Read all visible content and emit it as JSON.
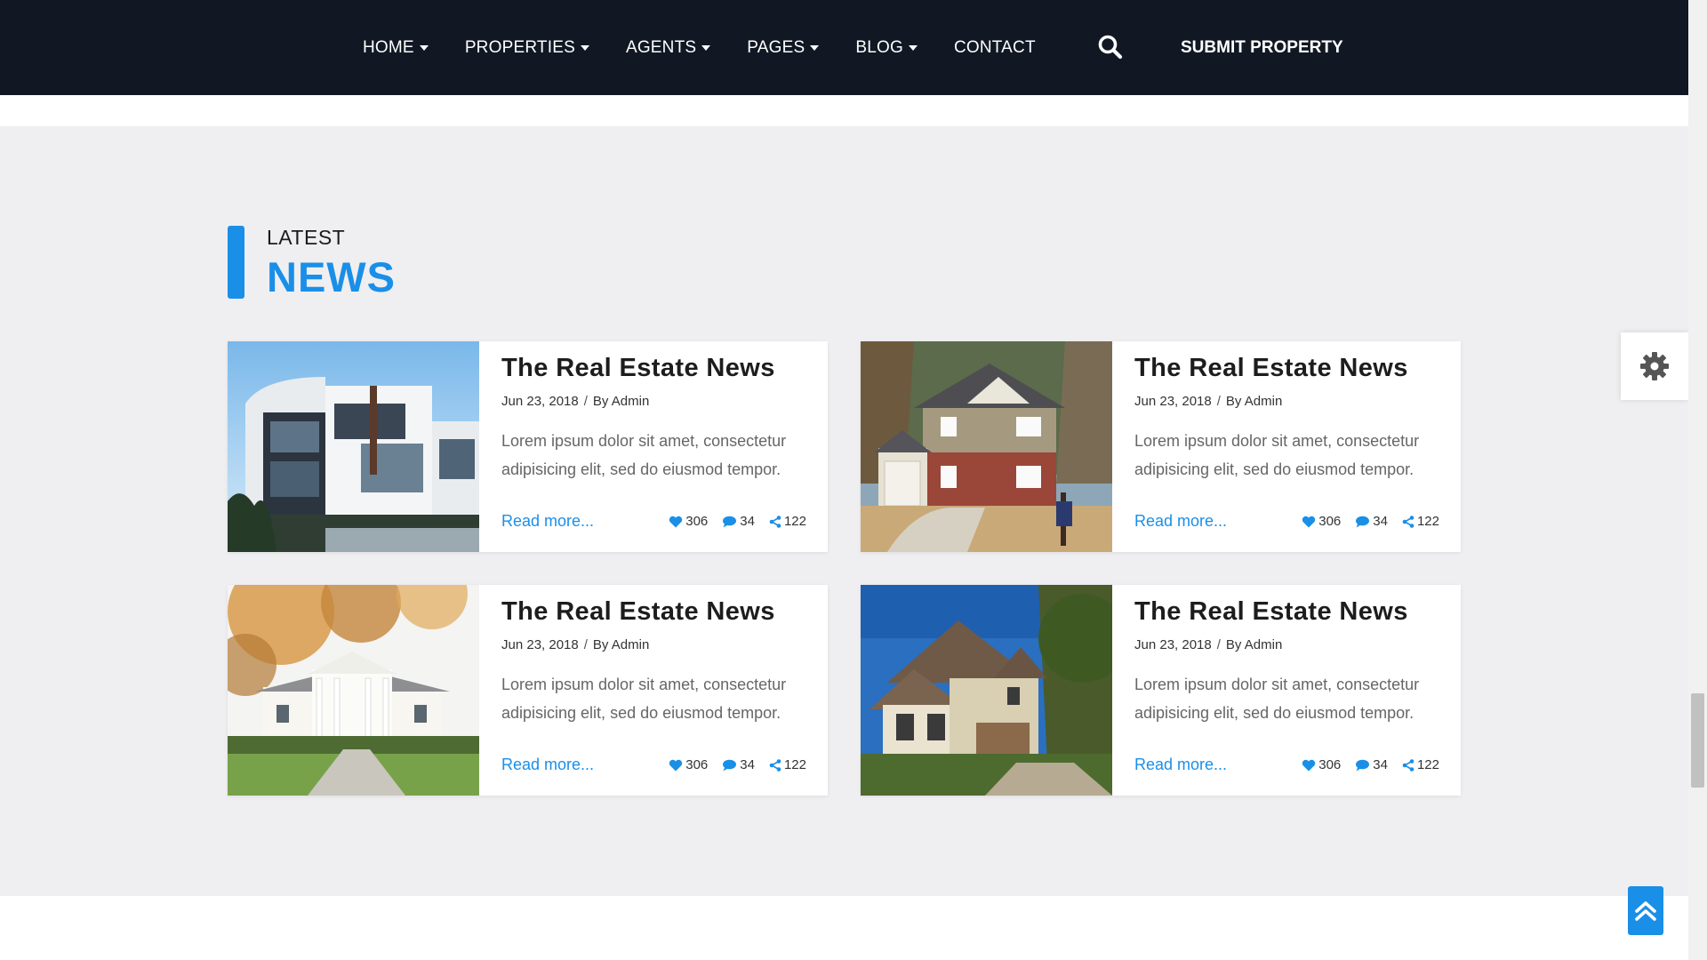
{
  "nav": {
    "items": [
      {
        "label": "HOME",
        "dropdown": true
      },
      {
        "label": "PROPERTIES",
        "dropdown": true
      },
      {
        "label": "AGENTS",
        "dropdown": true
      },
      {
        "label": "PAGES",
        "dropdown": true
      },
      {
        "label": "BLOG",
        "dropdown": true
      },
      {
        "label": "CONTACT",
        "dropdown": false
      }
    ],
    "search_icon": "search-icon",
    "submit_label": "SUBMIT PROPERTY"
  },
  "section": {
    "small_heading": "LATEST",
    "big_heading": "NEWS"
  },
  "cards": [
    {
      "title": "The Real Estate News",
      "date": "Jun 23, 2018",
      "author": "By Admin",
      "text": "Lorem ipsum dolor sit amet, consectetur adipisicing elit, sed do eiusmod tempor.",
      "read_more": "Read more...",
      "likes": "306",
      "comments": "34",
      "shares": "122"
    },
    {
      "title": "The Real Estate News",
      "date": "Jun 23, 2018",
      "author": "By Admin",
      "text": "Lorem ipsum dolor sit amet, consectetur adipisicing elit, sed do eiusmod tempor.",
      "read_more": "Read more...",
      "likes": "306",
      "comments": "34",
      "shares": "122"
    },
    {
      "title": "The Real Estate News",
      "date": "Jun 23, 2018",
      "author": "By Admin",
      "text": "Lorem ipsum dolor sit amet, consectetur adipisicing elit, sed do eiusmod tempor.",
      "read_more": "Read more...",
      "likes": "306",
      "comments": "34",
      "shares": "122"
    },
    {
      "title": "The Real Estate News",
      "date": "Jun 23, 2018",
      "author": "By Admin",
      "text": "Lorem ipsum dolor sit amet, consectetur adipisicing elit, sed do eiusmod tempor.",
      "read_more": "Read more...",
      "likes": "306",
      "comments": "34",
      "shares": "122"
    }
  ],
  "colors": {
    "navbar_bg": "#111824",
    "accent": "#1a8fe8",
    "section_bg": "#efeff1"
  },
  "floating": {
    "settings_icon": "gear-icon",
    "scroll_top_icon": "double-chevron-up-icon"
  }
}
